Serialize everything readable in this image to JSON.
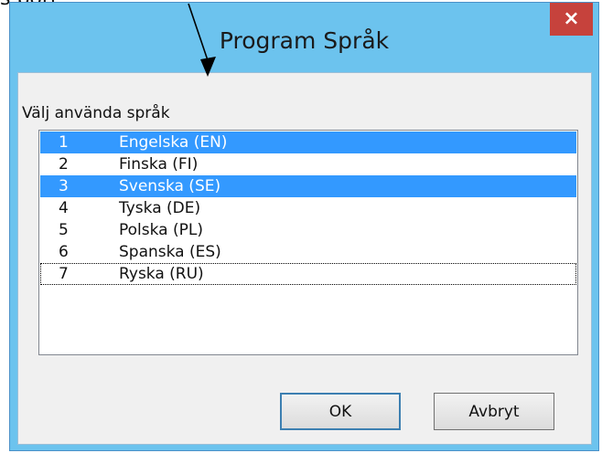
{
  "document": {
    "visible_text": "s bort."
  },
  "window": {
    "title": "Program Språk",
    "close_label": "×"
  },
  "dialog": {
    "prompt": "Välj använda språk",
    "languages": [
      {
        "number": "1",
        "name": "Engelska (EN)",
        "selected": true
      },
      {
        "number": "2",
        "name": "Finska (FI)",
        "selected": false
      },
      {
        "number": "3",
        "name": "Svenska (SE)",
        "selected": true
      },
      {
        "number": "4",
        "name": "Tyska (DE)",
        "selected": false
      },
      {
        "number": "5",
        "name": "Polska (PL)",
        "selected": false
      },
      {
        "number": "6",
        "name": "Spanska (ES)",
        "selected": false
      },
      {
        "number": "7",
        "name": "Ryska (RU)",
        "selected": false,
        "focused": true
      }
    ],
    "buttons": {
      "ok": "OK",
      "cancel": "Avbryt"
    }
  },
  "colors": {
    "title_bar": "#6cc3ee",
    "close_button": "#c6423c",
    "selection": "#3399ff",
    "client_background": "#f0f0f0"
  },
  "icons": {
    "close": "close-icon",
    "annotation_arrow": "arrow-icon"
  }
}
